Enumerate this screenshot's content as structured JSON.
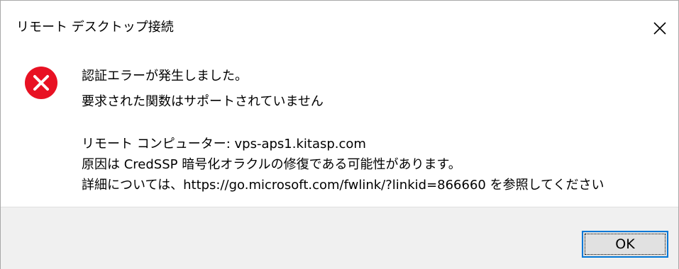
{
  "window": {
    "title": "リモート デスクトップ接続",
    "close_icon": "close-icon"
  },
  "message": {
    "icon": "error-icon",
    "icon_color": "#e81123",
    "line1": "認証エラーが発生しました。",
    "line2": "要求された関数はサポートされていません",
    "line3": "リモート コンピューター: vps-aps1.kitasp.com",
    "line4": "原因は CredSSP 暗号化オラクルの修復である可能性があります。",
    "line5": "詳細については、https://go.microsoft.com/fwlink/?linkid=866660 を参照してください"
  },
  "buttons": {
    "ok_label": "OK",
    "accent": "#0078d7"
  }
}
